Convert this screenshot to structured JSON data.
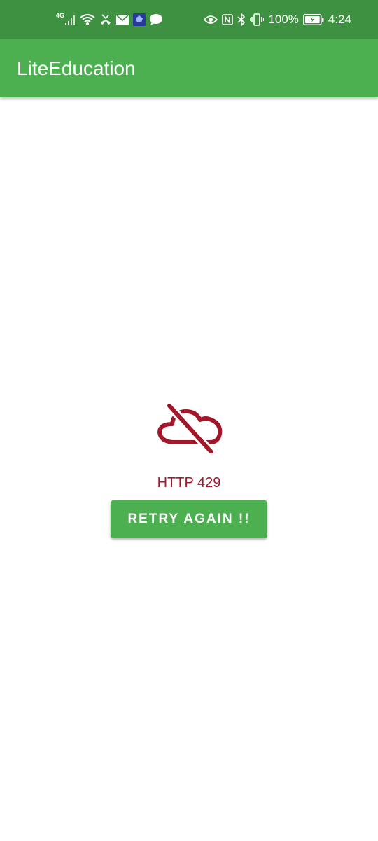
{
  "status_bar": {
    "network_type": "4G",
    "battery_percent": "100%",
    "time": "4:24",
    "left_icons": [
      "signal-icon",
      "wifi-icon",
      "missed-call-icon",
      "mail-icon",
      "app-notification-icon",
      "chat-icon"
    ],
    "right_icons": [
      "eye-icon",
      "nfc-icon",
      "bluetooth-icon",
      "vibrate-icon",
      "battery-icon"
    ]
  },
  "app_bar": {
    "title": "LiteEducation"
  },
  "error": {
    "icon": "cloud-off-icon",
    "message": "HTTP 429",
    "color": "#a3172b"
  },
  "retry_button": {
    "label": "RETRY AGAIN !!"
  },
  "colors": {
    "status_bar": "#3f9142",
    "primary": "#4caf50",
    "error": "#a3172b",
    "background": "#ffffff"
  }
}
